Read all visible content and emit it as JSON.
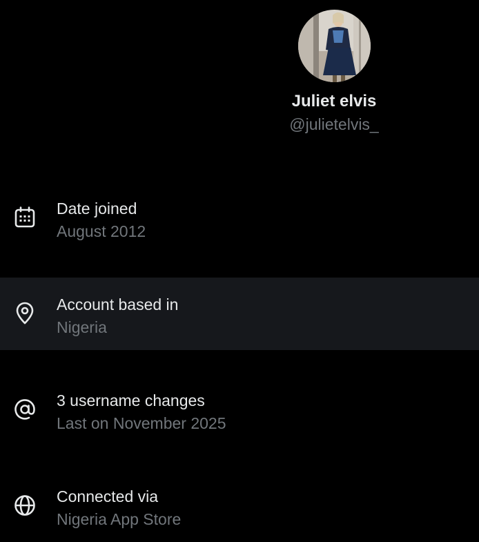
{
  "profile": {
    "display_name": "Juliet elvis",
    "handle": "@julietelvis_"
  },
  "rows": [
    {
      "icon": "calendar-icon",
      "title": "Date joined",
      "subtitle": "August 2012"
    },
    {
      "icon": "location-pin-icon",
      "title": "Account based in",
      "subtitle": "Nigeria"
    },
    {
      "icon": "at-sign-icon",
      "title": "3 username changes",
      "subtitle": "Last on November 2025"
    },
    {
      "icon": "globe-icon",
      "title": "Connected via",
      "subtitle": "Nigeria App Store"
    }
  ],
  "colors": {
    "background": "#000000",
    "highlight_row": "#16181c",
    "primary_text": "#e7e9ea",
    "secondary_text": "#71767b"
  }
}
